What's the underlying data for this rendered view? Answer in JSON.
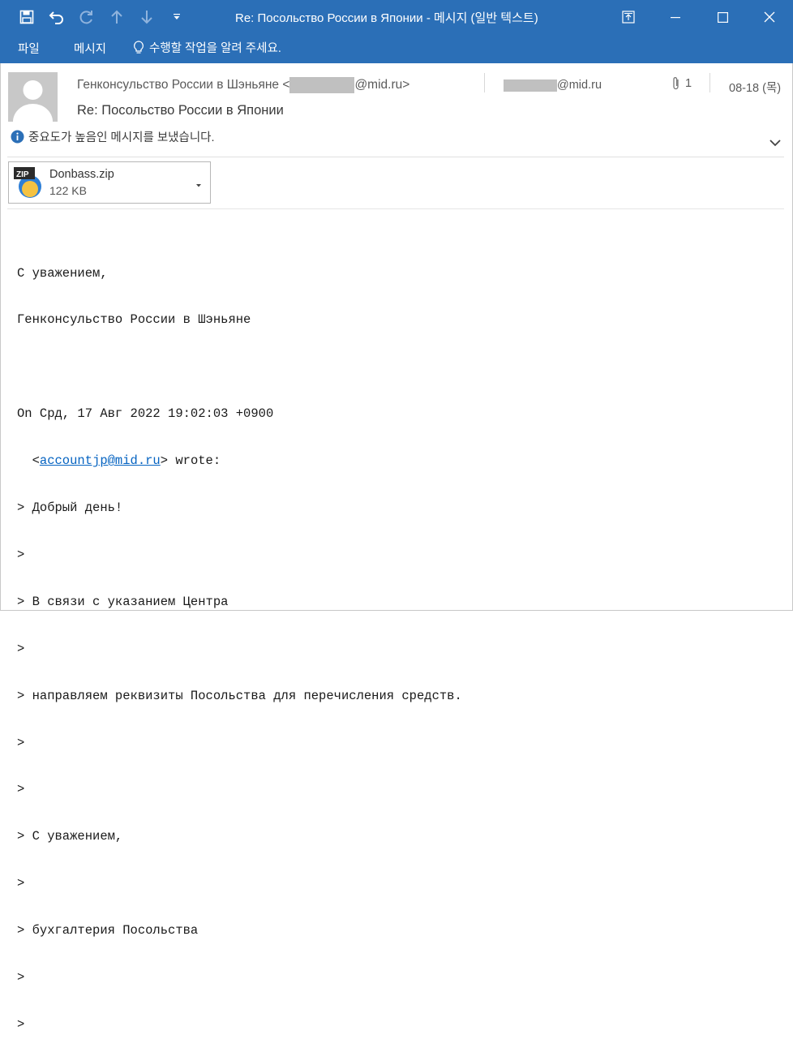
{
  "window": {
    "title": "Re: Посольство России в Японии - 메시지 (일반 텍스트)",
    "controls": [
      "restore-ribbon-icon",
      "minimize-icon",
      "maximize-icon",
      "close-icon"
    ]
  },
  "quick_access": [
    "save-icon",
    "undo-icon",
    "redo-icon",
    "previous-item-icon",
    "next-item-icon",
    "customize-icon"
  ],
  "ribbon": {
    "tabs": [
      "파일",
      "메시지"
    ],
    "tell_me": "수행할 작업을 알려 주세요."
  },
  "message": {
    "from_name": "Генконсульство России в Шэньяне",
    "from_open": "<",
    "from_domain": "@mid.ru>",
    "subject": "Re: Посольство России в Японии",
    "to_domain": "@mid.ru",
    "attachment_count": "1",
    "date": "08-18 (목)",
    "importance": "중요도가 높음인 메시지를 보냈습니다."
  },
  "attachment": {
    "name": "Donbass.zip",
    "size": "122 KB",
    "badge": "ZIP"
  },
  "body": {
    "lines": [
      "С уважением,",
      "Генконсульство России в Шэньяне",
      "",
      "On Срд, 17 Авг 2022 19:02:03 +0900",
      "> Добрый день!",
      ">",
      "> В связи с указанием Центра",
      ">",
      "> направляем реквизиты Посольства для перечисления средств.",
      ">",
      ">",
      "> С уважением,",
      ">",
      "> бухгалтерия Посольства",
      ">",
      ">"
    ],
    "quote_prefix": "  <",
    "quote_email": "accountjp@mid.ru",
    "quote_suffix": "> wrote:"
  },
  "colors": {
    "title_bar": "#2b6fb7",
    "link": "#0563c1",
    "info_icon": "#2b6fb7"
  }
}
